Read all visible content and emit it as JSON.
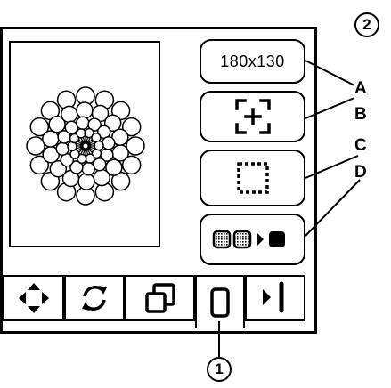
{
  "callouts": {
    "figure_number": "2",
    "pointer_number": "1",
    "letter_a": "A",
    "letter_b": "B",
    "letter_c": "C",
    "letter_d": "D"
  },
  "side_buttons": {
    "size_label": "180x130"
  },
  "icons": {
    "center_button": "crosshair-plus-icon",
    "frame_button": "dotted-square-icon",
    "stitch_button": "stitch-sequence-icon",
    "tab_move": "four-direction-arrows-icon",
    "tab_rotate": "rotate-arrows-icon",
    "tab_size": "overlapping-squares-icon",
    "tab_frame": "hoop-frame-icon",
    "tab_sew": "needle-sew-icon",
    "design": "flower-embroidery-design-icon"
  },
  "colors": {
    "line": "#000000",
    "background": "#ffffff"
  }
}
